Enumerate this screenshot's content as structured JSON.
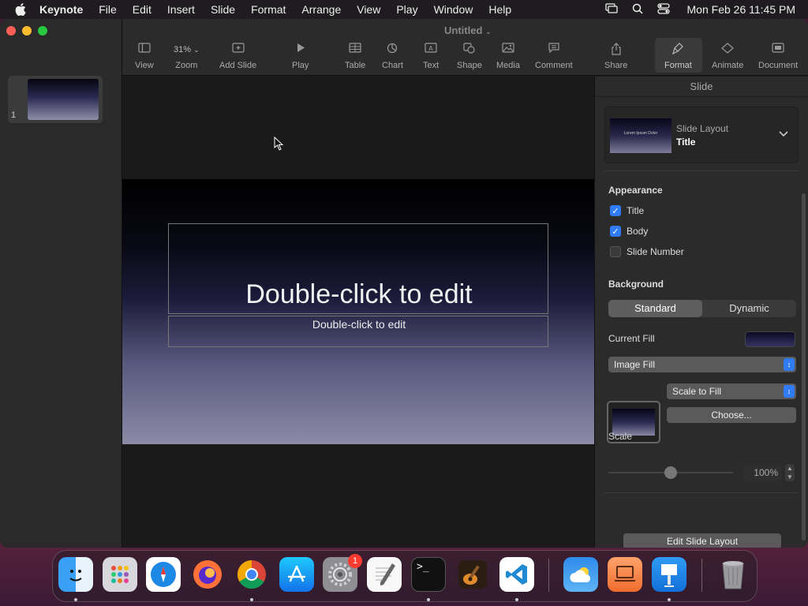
{
  "menubar": {
    "app": "Keynote",
    "items": [
      "File",
      "Edit",
      "Insert",
      "Slide",
      "Format",
      "Arrange",
      "View",
      "Play",
      "Window",
      "Help"
    ],
    "clock": "Mon Feb 26  11:45 PM"
  },
  "window": {
    "title": "Untitled"
  },
  "sidebar": {
    "slides": [
      {
        "number": "1"
      }
    ]
  },
  "toolbar": {
    "view": "View",
    "zoom_value": "31%",
    "zoom": "Zoom",
    "add_slide": "Add Slide",
    "play": "Play",
    "table": "Table",
    "chart": "Chart",
    "text": "Text",
    "shape": "Shape",
    "media": "Media",
    "comment": "Comment",
    "share": "Share",
    "format": "Format",
    "animate": "Animate",
    "document": "Document"
  },
  "slide": {
    "title_placeholder": "Double-click to edit",
    "body_placeholder": "Double-click to edit"
  },
  "inspector": {
    "header": "Slide",
    "layout_label": "Slide Layout",
    "layout_value": "Title",
    "layout_thumb_text": "Lorem Ipsum Dolor",
    "appearance": {
      "title": "Appearance",
      "options": [
        {
          "label": "Title",
          "checked": true
        },
        {
          "label": "Body",
          "checked": true
        },
        {
          "label": "Slide Number",
          "checked": false
        }
      ]
    },
    "background": {
      "title": "Background",
      "segments": [
        "Standard",
        "Dynamic"
      ],
      "selected": "Standard",
      "current_fill_label": "Current Fill",
      "fill_type": "Image Fill",
      "scale_mode": "Scale to Fill",
      "choose_button": "Choose...",
      "scale_label": "Scale",
      "scale_value": "100%",
      "scale_fraction": 0.5
    },
    "edit_layout_button": "Edit Slide Layout"
  },
  "dock": {
    "apps": [
      "Finder",
      "Launchpad",
      "Safari",
      "Firefox",
      "Chrome",
      "App Store",
      "System Settings",
      "TextEdit",
      "Terminal",
      "GarageBand",
      "VS Code",
      "Weather",
      "Keynote Remote",
      "Keynote",
      "Trash"
    ],
    "badge": "1"
  },
  "colors": {
    "accent": "#2f7cf6",
    "close": "#ff5f57",
    "minimize": "#febc2e",
    "maximize": "#28c840"
  }
}
